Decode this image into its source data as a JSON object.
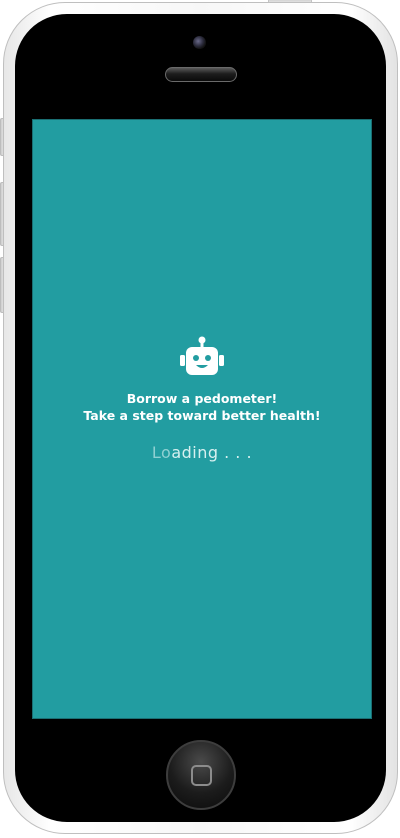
{
  "app": {
    "tagline_line1": "Borrow a pedometer!",
    "tagline_line2": "Take a step toward better health!",
    "loading_prefix": "Lo",
    "loading_suffix": "ading . . ."
  },
  "icons": {
    "logo": "robot-icon",
    "home": "home-button-icon"
  },
  "colors": {
    "screen_background": "#229da1",
    "text": "#ffffff",
    "loading_text": "#d7f0f0",
    "loading_highlight": "#8fd0d2",
    "device_body": "#000000",
    "device_frame": "#f5f5f5"
  }
}
